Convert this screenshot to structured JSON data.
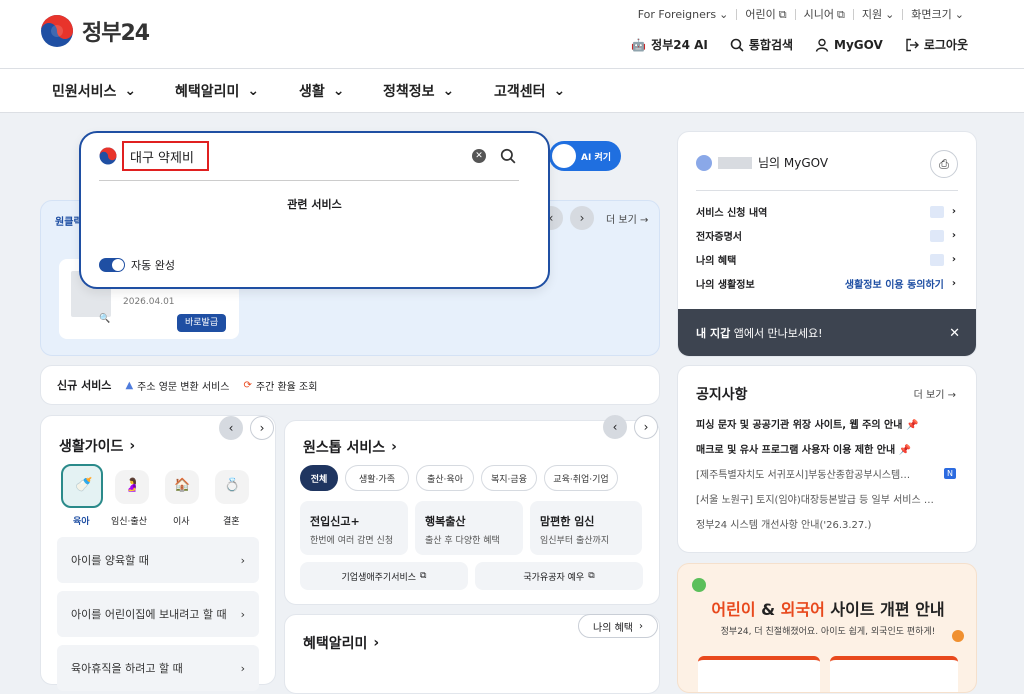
{
  "header": {
    "logo_text": "정부24",
    "util_links": [
      "For Foreigners",
      "어린이",
      "시니어",
      "지원",
      "화면크기"
    ],
    "ai_label": "정부24 AI",
    "search_label": "통합검색",
    "mygov_label": "MyGOV",
    "logout_label": "로그아웃"
  },
  "nav": [
    "민원서비스",
    "혜택알리미",
    "생활",
    "정책정보",
    "고객센터"
  ],
  "search": {
    "query": "대구 약제비",
    "related_heading": "관련 서비스",
    "autocomplete_label": "자동 완성",
    "ai_toggle_label": "AI 켜기"
  },
  "behind_card": {
    "tab_label": "원클릭",
    "more_label": "더 보기 →",
    "doc_date": "2026.04.01",
    "issue_button": "바로발급"
  },
  "new_services": {
    "title": "신규 서비스",
    "items": [
      "주소 영문 변환 서비스",
      "주간 환율 조회"
    ]
  },
  "life_guide": {
    "title": "생활가이드",
    "categories": [
      "육아",
      "임신·출산",
      "이사",
      "결혼"
    ],
    "items": [
      "아이를 양육할 때",
      "아이를 어린이집에 보내려고 할 때",
      "육아휴직을 하려고 할 때"
    ]
  },
  "onestop": {
    "title": "원스톱 서비스",
    "chips": [
      "전체",
      "생활·가족",
      "출산·육아",
      "복지·금융",
      "교육·취업·기업"
    ],
    "cards": [
      {
        "title": "전입신고+",
        "desc": "한번에 여러 감면 신청"
      },
      {
        "title": "행복출산",
        "desc": "출산 후 다양한 혜택"
      },
      {
        "title": "맘편한 임신",
        "desc": "임신부터 출산까지"
      }
    ],
    "links": [
      "기업생애주기서비스",
      "국가유공자 예우"
    ]
  },
  "benefit": {
    "title": "혜택알리미",
    "my_benefit_label": "나의 혜택"
  },
  "mygov": {
    "user_suffix": "님의 MyGOV",
    "rows": [
      "서비스 신청 내역",
      "전자증명서",
      "나의 혜택",
      "나의 생활정보"
    ],
    "consent_link": "생활정보 이용 동의하기",
    "wallet_bold": "내 지갑",
    "wallet_text": " 앱에서 만나보세요!"
  },
  "notices": {
    "title": "공지사항",
    "more_label": "더 보기 →",
    "items": [
      {
        "text": "피싱 문자 및 공공기관 위장 사이트, 웹 주의 안내",
        "pinned": true
      },
      {
        "text": "매크로 및 유사 프로그램 사용자 이용 제한 안내",
        "pinned": true
      },
      {
        "text": "[제주특별자치도 서귀포시]부동산종합공부시스템…",
        "badge": "N"
      },
      {
        "text": "[서울 노원구] 토지(임야)대장등본발급 등 일부 서비스 …"
      },
      {
        "text": "정부24 시스템 개선사항 안내('26.3.27.)"
      }
    ]
  },
  "banner": {
    "title_a": "어린이",
    "title_amp": " & ",
    "title_b": "외국어",
    "title_rest": " 사이트 개편 안내",
    "subtitle": "정부24, 더 친절해졌어요. 아이도 쉽게, 외국인도 편하게!"
  },
  "colors": {
    "primary": "#1f4fa3",
    "accent": "#e8491d",
    "dark": "#3d4450"
  }
}
